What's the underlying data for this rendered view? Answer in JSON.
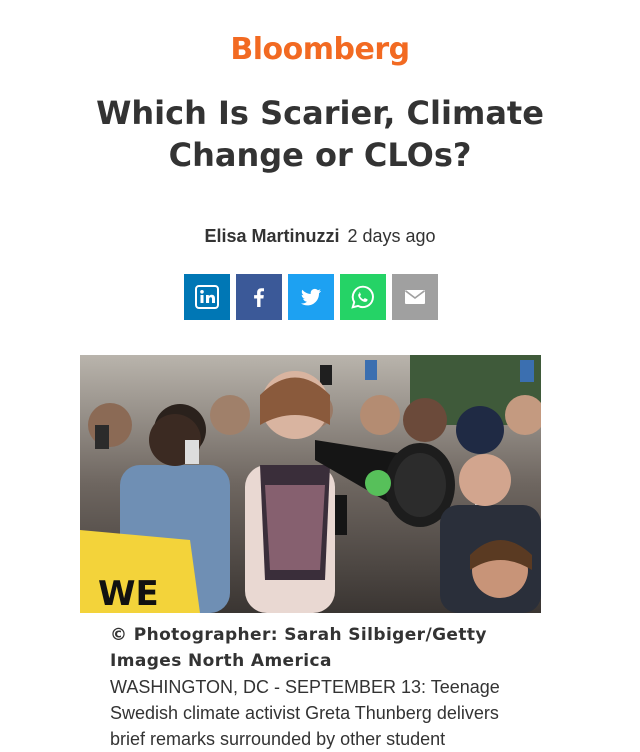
{
  "header": {
    "brand": "Bloomberg",
    "brand_color": "#f26a22"
  },
  "article": {
    "title": "Which Is Scarier, Climate Change or CLOs?",
    "author": "Elisa Martinuzzi",
    "time_ago": "2 days ago"
  },
  "share": {
    "buttons": [
      {
        "icon": "linkedin-icon",
        "color": "#0077b5"
      },
      {
        "icon": "facebook-icon",
        "color": "#3b5998"
      },
      {
        "icon": "twitter-icon",
        "color": "#1da1f2"
      },
      {
        "icon": "whatsapp-icon",
        "color": "#25d366"
      },
      {
        "icon": "email-icon",
        "color": "#a0a0a0"
      }
    ]
  },
  "photo": {
    "credit": "© Photographer: Sarah Silbiger/Getty Images North America",
    "description": "WASHINGTON, DC - SEPTEMBER 13: Teenage Swedish climate activist Greta Thunberg delivers brief remarks surrounded by other student"
  }
}
